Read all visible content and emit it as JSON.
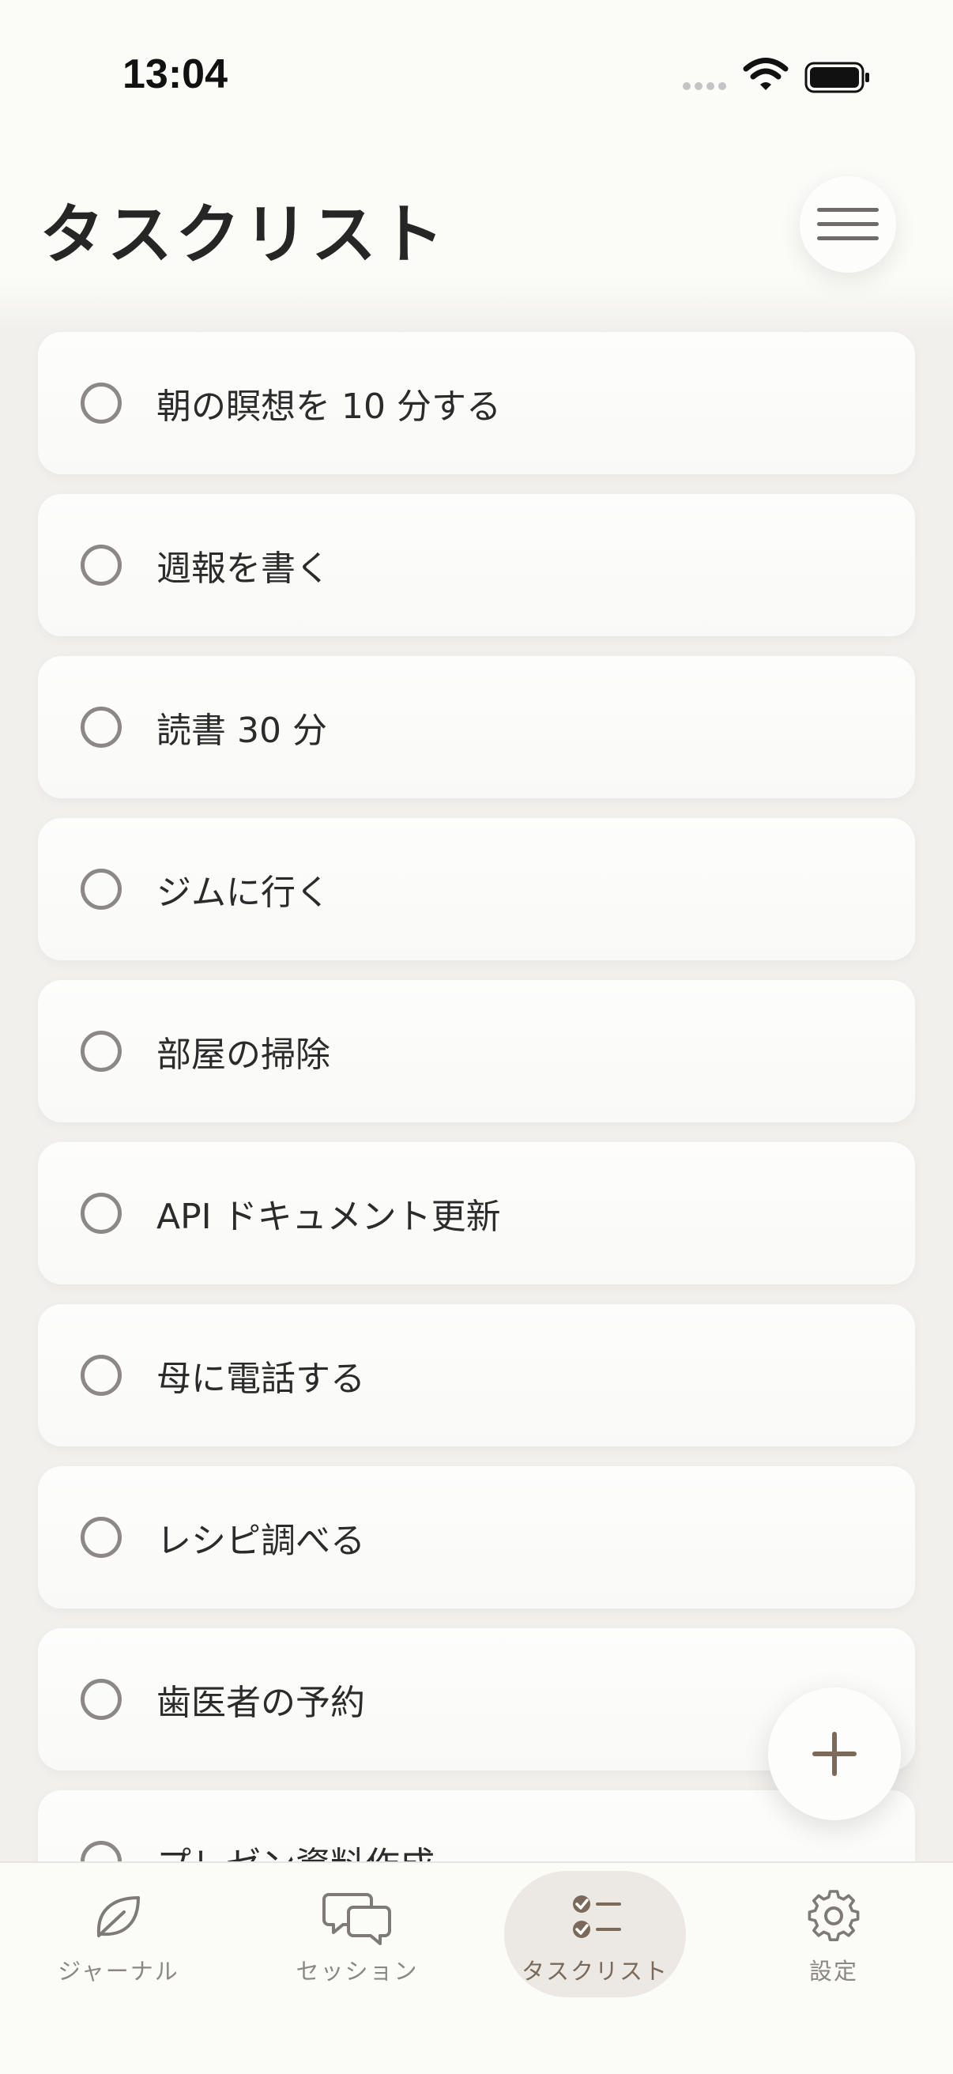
{
  "status_bar": {
    "time": "13:04"
  },
  "header": {
    "title": "タスクリスト"
  },
  "tasks": [
    {
      "label": "朝の瞑想を 10 分する"
    },
    {
      "label": "週報を書く"
    },
    {
      "label": "読書 30 分"
    },
    {
      "label": "ジムに行く"
    },
    {
      "label": "部屋の掃除"
    },
    {
      "label": "API ドキュメント更新"
    },
    {
      "label": "母に電話する"
    },
    {
      "label": "レシピ調べる"
    },
    {
      "label": "歯医者の予約"
    },
    {
      "label": "プレゼン資料作成"
    }
  ],
  "tab_bar": {
    "items": [
      {
        "label": "ジャーナル",
        "icon": "leaf-icon"
      },
      {
        "label": "セッション",
        "icon": "chat-bubbles-icon"
      },
      {
        "label": "タスクリスト",
        "icon": "checklist-icon",
        "active": true
      },
      {
        "label": "設定",
        "icon": "gear-icon"
      }
    ]
  },
  "colors": {
    "background": "#f1f0ed",
    "card": "#fdfdfc",
    "accent_brown": "#7b6a59",
    "active_tab_bg": "#ece8e3",
    "checkbox_border": "#8b8885"
  }
}
